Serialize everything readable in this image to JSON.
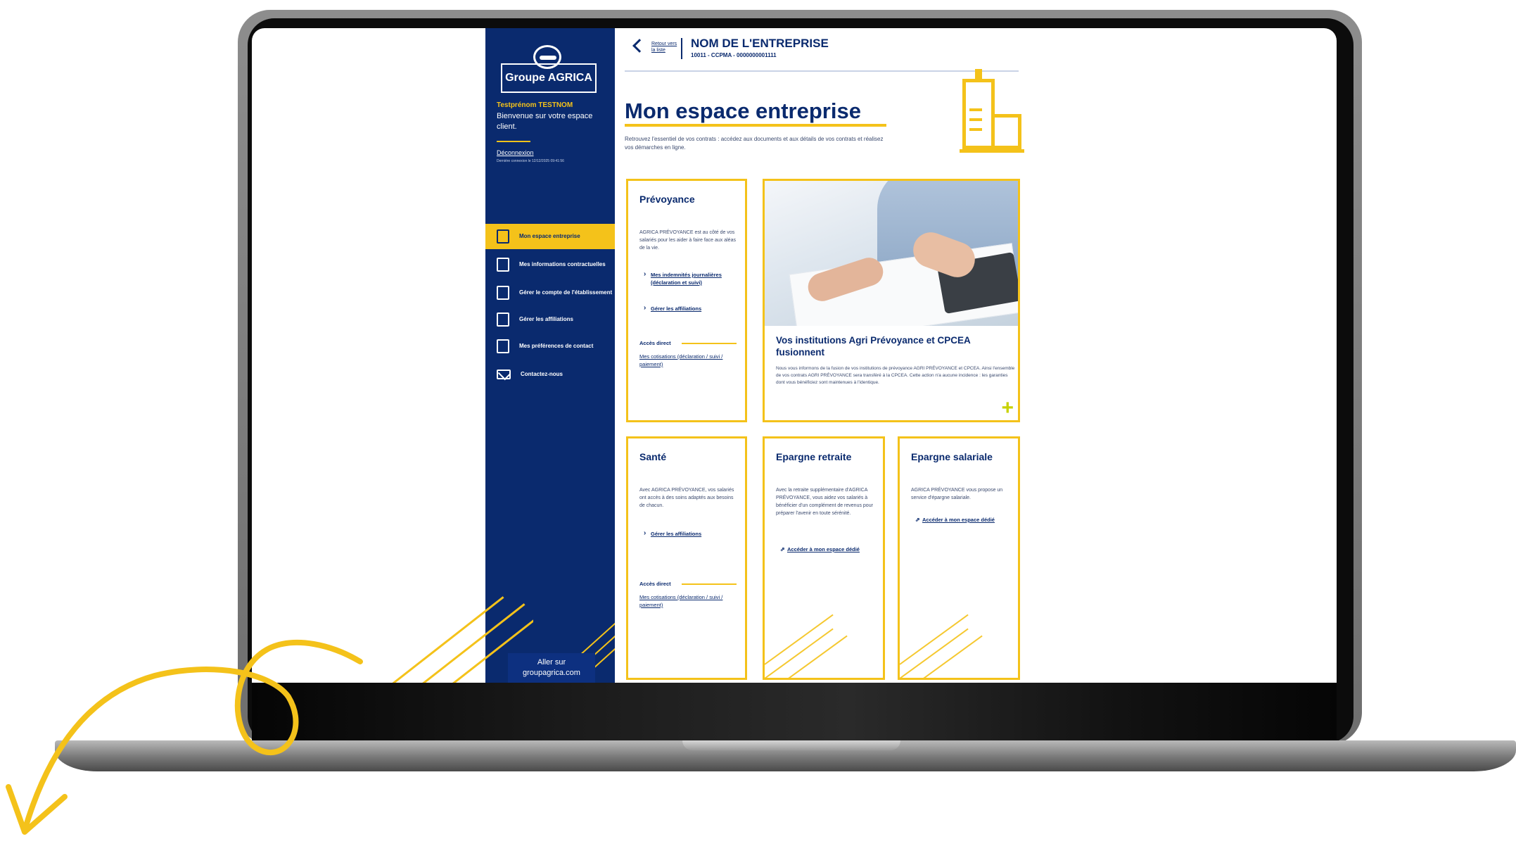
{
  "colors": {
    "navy": "#0a2a6e",
    "yellow": "#f4c21a",
    "lime_plus": "#c8d200"
  },
  "sidebar": {
    "logo_text": "Groupe AGRICA",
    "user_name": "Testprénom TESTNOM",
    "welcome_text": "Bienvenue sur votre espace client.",
    "logout_label": "Déconnexion",
    "last_login_text": "Dernière connexion le 12/12/2025 09:41:56",
    "nav_items": [
      {
        "label": "Mon espace entreprise",
        "icon": "building-icon",
        "active": true
      },
      {
        "label": "Mes informations contractuelles",
        "icon": "document-edit-icon",
        "active": false
      },
      {
        "label": "Gérer le compte de l'établissement",
        "icon": "account-icon",
        "active": false
      },
      {
        "label": "Gérer les affiliations",
        "icon": "document-edit-icon",
        "active": false
      },
      {
        "label": "Mes préférences de contact",
        "icon": "document-icon",
        "active": false
      },
      {
        "label": "Contactez-nous",
        "icon": "envelope-icon",
        "active": false
      }
    ],
    "goto_label": "Aller sur groupagrica.com"
  },
  "header": {
    "back_label": "Retour vers la liste",
    "company_name": "NOM DE L'ENTREPRISE",
    "company_id": "10011 - CCPMA - 0000000001111"
  },
  "main": {
    "title": "Mon espace entreprise",
    "intro": "Retrouvez l'essentiel de vos contrats : accédez aux documents et aux détails de vos contrats et réalisez vos démarches en ligne."
  },
  "cards": {
    "prevoyance": {
      "title": "Prévoyance",
      "text": "AGRICA PRÉVOYANCE est au côté de vos salariés pour les aider à faire face aux aléas de la vie.",
      "link1": "Mes indemnités journalières (déclaration et suivi)",
      "link2": "Gérer les affiliations",
      "direct_label": "Accès direct",
      "direct_link": "Mes cotisations (déclaration / suivi / paiement)"
    },
    "news": {
      "title": "Vos institutions Agri Prévoyance et CPCEA fusionnent",
      "text": "Nous vous informons de la fusion de vos institutions de prévoyance AGRI PRÉVOYANCE et CPCEA. Ainsi l'ensemble de vos contrats AGRI PRÉVOYANCE sera transféré à la CPCEA. Cette action n'a aucune incidence : les garanties dont vous bénéficiez sont maintenues à l'identique.",
      "plus_symbol": "+"
    },
    "sante": {
      "title": "Santé",
      "text": "Avec AGRICA PRÉVOYANCE, vos salariés ont accès à des soins adaptés aux besoins de chacun.",
      "link1": "Gérer les affiliations",
      "direct_label": "Accès direct",
      "direct_link": "Mes cotisations (déclaration / suivi / paiement)"
    },
    "retraite": {
      "title": "Epargne retraite",
      "text": "Avec la retraite supplémentaire d'AGRICA PRÉVOYANCE, vous aidez vos salariés à bénéficier d'un complément de revenus pour préparer l'avenir en toute sérénité.",
      "link1": "Accéder à mon espace dédié"
    },
    "salariale": {
      "title": "Epargne salariale",
      "text": "AGRICA PRÉVOYANCE vous propose un service d'épargne salariale.",
      "link1": "Accéder à mon espace dédié"
    }
  }
}
